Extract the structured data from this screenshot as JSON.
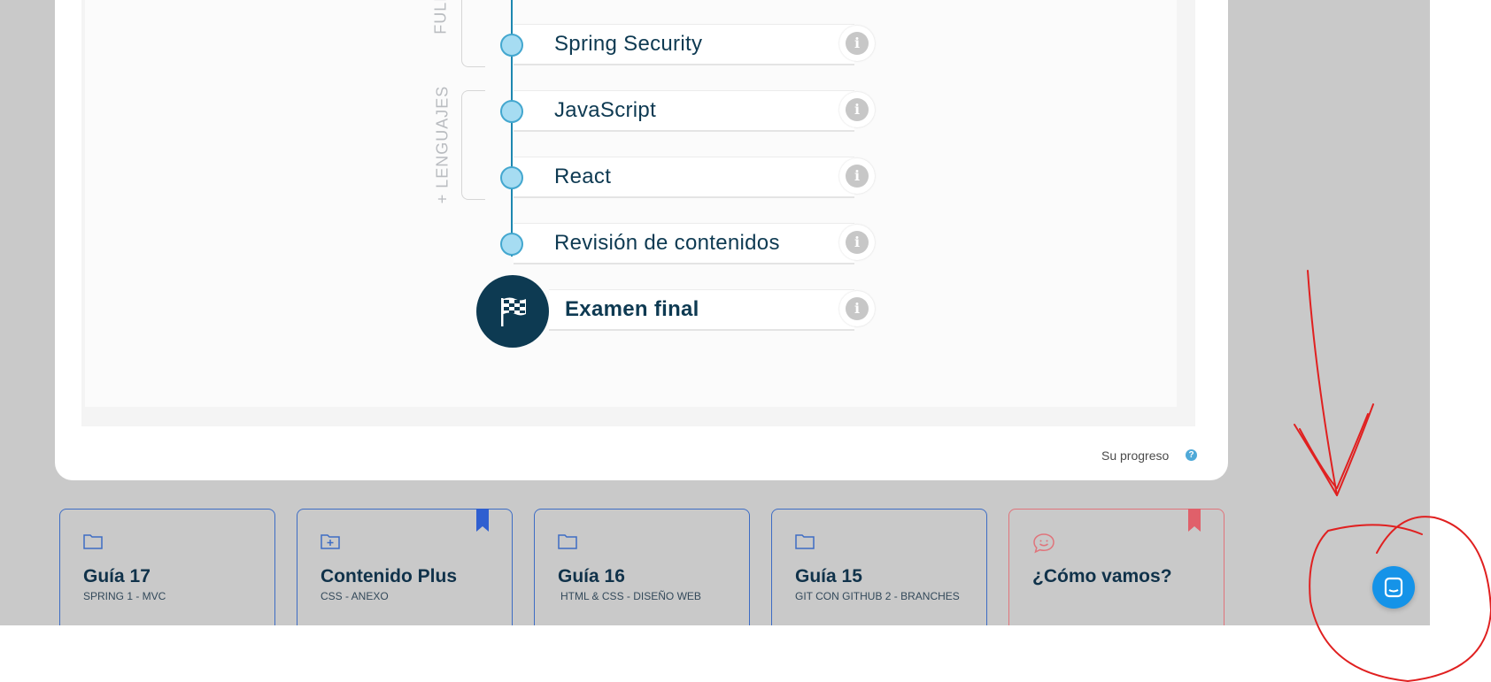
{
  "curriculum": {
    "groups": [
      {
        "label": "FULL S"
      },
      {
        "label": "+ LENGUAJES"
      }
    ],
    "items": [
      {
        "label": "Spring Security"
      },
      {
        "label": "JavaScript"
      },
      {
        "label": "React"
      },
      {
        "label": "Revisión de contenidos"
      }
    ],
    "final": {
      "label": "Examen final"
    },
    "progress_label": "Su progreso",
    "help_glyph": "?"
  },
  "guides": [
    {
      "title": "Guía 17",
      "subtitle": "SPRING 1 - MVC",
      "icon": "folder-icon",
      "bookmarked": false
    },
    {
      "title": "Contenido Plus",
      "subtitle": "CSS - ANEXO",
      "icon": "folder-plus-icon",
      "bookmarked": true
    },
    {
      "title": "Guía 16",
      "subtitle": "HTML & CSS - DISEÑO WEB",
      "icon": "folder-icon",
      "bookmarked": false
    },
    {
      "title": "Guía 15",
      "subtitle": "GIT CON GITHUB 2 - BRANCHES",
      "icon": "folder-icon",
      "bookmarked": false
    },
    {
      "title": "¿Cómo vamos?",
      "subtitle": "",
      "icon": "smile-chat-icon",
      "bookmarked": true
    }
  ],
  "colors": {
    "background": "#c9c9c9",
    "node_fill": "#a6dcf2",
    "node_line": "#1d87b0",
    "final_node": "#0d3a52",
    "card_border": "#3d6cc4",
    "feedback_border": "#e0747b",
    "chat_button": "#1593e8",
    "annotation": "#e02020"
  }
}
